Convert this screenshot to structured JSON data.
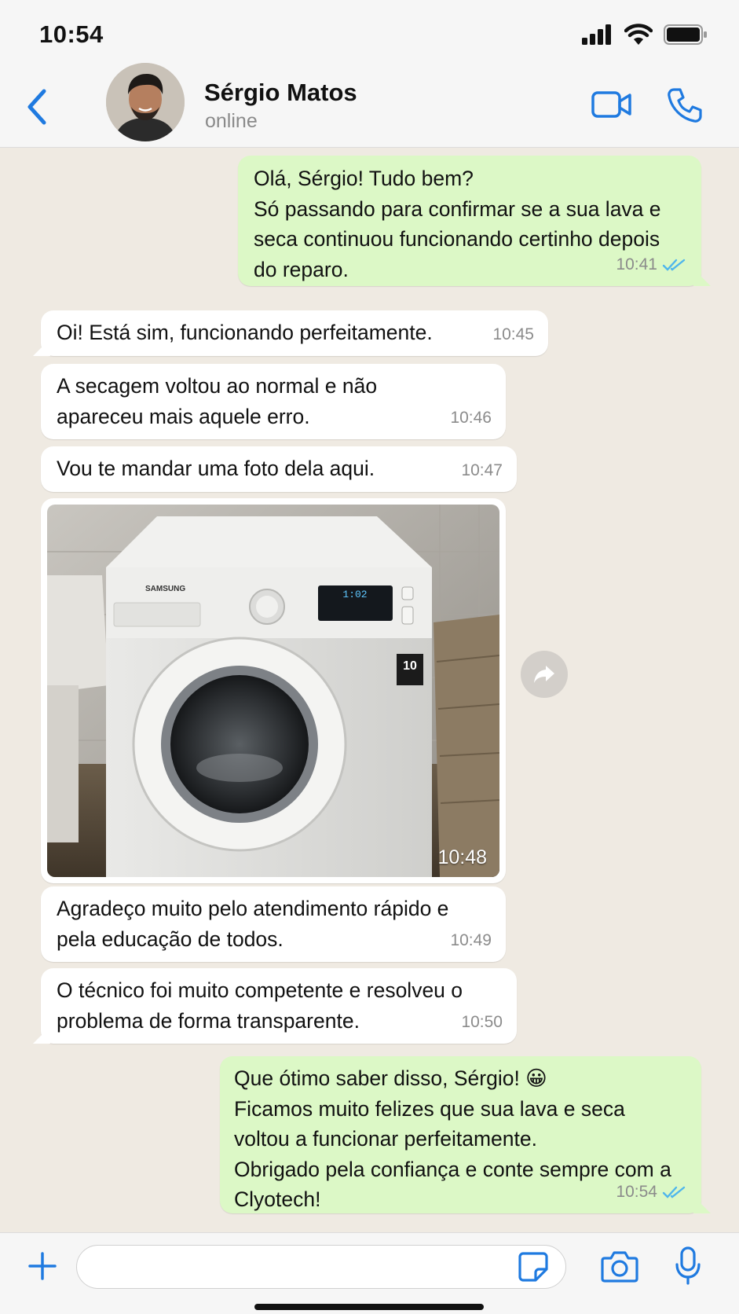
{
  "status_bar": {
    "time": "10:54",
    "signal_icon": "cellular-signal-icon",
    "wifi_icon": "wifi-icon",
    "battery_icon": "battery-full-icon"
  },
  "header": {
    "contact_name": "Sérgio Matos",
    "contact_status": "online",
    "back_icon": "chevron-left-icon",
    "video_icon": "video-camera-icon",
    "call_icon": "phone-icon"
  },
  "messages": [
    {
      "direction": "out",
      "text": "Olá, Sérgio! Tudo bem?\nSó passando para confirmar se a sua lava e seca continuou funcionando certinho depois do reparo.",
      "time": "10:41",
      "read": true
    },
    {
      "direction": "in",
      "text": "Oi! Está sim, funcionando perfeitamente.",
      "time": "10:45"
    },
    {
      "direction": "in",
      "text": "A secagem voltou ao normal e não apareceu mais aquele erro.",
      "time": "10:46"
    },
    {
      "direction": "in",
      "text": "Vou te mandar uma foto dela aqui.",
      "time": "10:47"
    },
    {
      "direction": "in",
      "type": "image",
      "image_description": "washing-machine-photo",
      "time": "10:48",
      "brand_text": "SAMSUNG",
      "display_text": "1:02"
    },
    {
      "direction": "in",
      "text": "Agradeço muito pelo atendimento rápido e pela educação de todos.",
      "time": "10:49"
    },
    {
      "direction": "in",
      "text": "O técnico foi muito competente e resolveu o problema de forma transparente.",
      "time": "10:50"
    },
    {
      "direction": "out",
      "text": "Que ótimo saber disso, Sérgio! 😀\nFicamos muito felizes que sua lava e seca voltou a funcionar perfeitamente.\nObrigado pela confiança e conte sempre com a Clyotech!",
      "time": "10:54",
      "read": true
    }
  ],
  "composer": {
    "placeholder": "",
    "value": ""
  },
  "colors": {
    "accent": "#1f7ae0",
    "outgoing_bubble": "#dcf8c6",
    "incoming_bubble": "#ffffff",
    "chat_bg": "#efeae2",
    "read_ticks": "#4fb6ec"
  }
}
